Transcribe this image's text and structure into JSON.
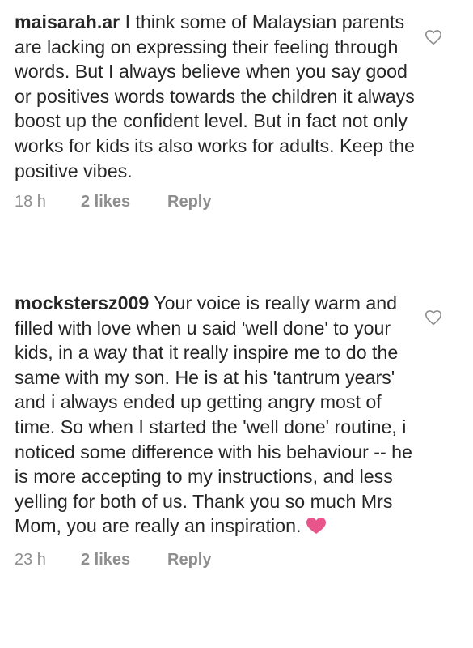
{
  "comments": [
    {
      "username": "maisarah.ar",
      "text": "I think some of Malaysian parents are lacking on expressing their feeling through words. But I always believe when you say good or positives words towards the children it always boost up the confident level. But in fact not only works for kids its also works for adults. Keep the positive vibes.",
      "time": "18 h",
      "likes": "2 likes",
      "reply": "Reply"
    },
    {
      "username": "mockstersz009",
      "text": "Your voice is really warm and filled with love when u said 'well done' to your kids, in a way that it really inspire me to do the same with my son. He is at his 'tantrum years' and i always ended up getting angry most of time. So when I started the 'well done' routine, i noticed some difference with his behaviour -- he is more accepting to my instructions, and less yelling for both of us. Thank you so much Mrs Mom, you are really an inspiration.",
      "time": "23 h",
      "likes": "2 likes",
      "reply": "Reply"
    }
  ],
  "icons": {
    "like": "heart-outline-icon",
    "emoji": "pink-heart-emoji-icon"
  },
  "colors": {
    "text": "#262626",
    "meta": "#8e8e8e",
    "emoji_heart": "#e8558b"
  }
}
